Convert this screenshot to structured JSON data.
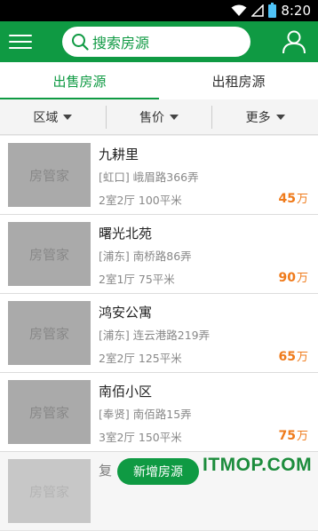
{
  "status_bar": {
    "time": "8:20",
    "battery_level": "8",
    "icons": [
      "wifi-icon",
      "signal-icon",
      "battery-icon"
    ]
  },
  "header": {
    "search_placeholder": "搜索房源",
    "icons": [
      "menu-icon",
      "search-icon",
      "user-icon"
    ]
  },
  "tabs": [
    {
      "label": "出售房源",
      "active": true
    },
    {
      "label": "出租房源",
      "active": false
    }
  ],
  "filters": [
    {
      "label": "区域"
    },
    {
      "label": "售价"
    },
    {
      "label": "更多"
    }
  ],
  "listings": [
    {
      "thumb_label": "房管家",
      "name": "九耕里",
      "district": "[虹口]",
      "street": "峨眉路366弄",
      "layout": "2室2厅",
      "area": "100平米",
      "price": "45",
      "unit": "万"
    },
    {
      "thumb_label": "房管家",
      "name": "曙光北苑",
      "district": "[浦东]",
      "street": "南桥路86弄",
      "layout": "2室1厅",
      "area": "75平米",
      "price": "90",
      "unit": "万"
    },
    {
      "thumb_label": "房管家",
      "name": "鸿安公寓",
      "district": "[浦东]",
      "street": "连云港路219弄",
      "layout": "2室2厅",
      "area": "125平米",
      "price": "65",
      "unit": "万"
    },
    {
      "thumb_label": "房管家",
      "name": "南佰小区",
      "district": "[奉贤]",
      "street": "南佰路15弄",
      "layout": "3室2厅",
      "area": "150平米",
      "price": "75",
      "unit": "万"
    },
    {
      "thumb_label": "房管家",
      "name": "复",
      "district": "",
      "street": "",
      "layout": "",
      "area": "",
      "price": "",
      "unit": ""
    }
  ],
  "add_button": {
    "label": "新增房源"
  },
  "watermark": {
    "text": "ITMOP.COM"
  },
  "colors": {
    "brand_green": "#0f9a43",
    "price_orange": "#ef7a1a"
  }
}
